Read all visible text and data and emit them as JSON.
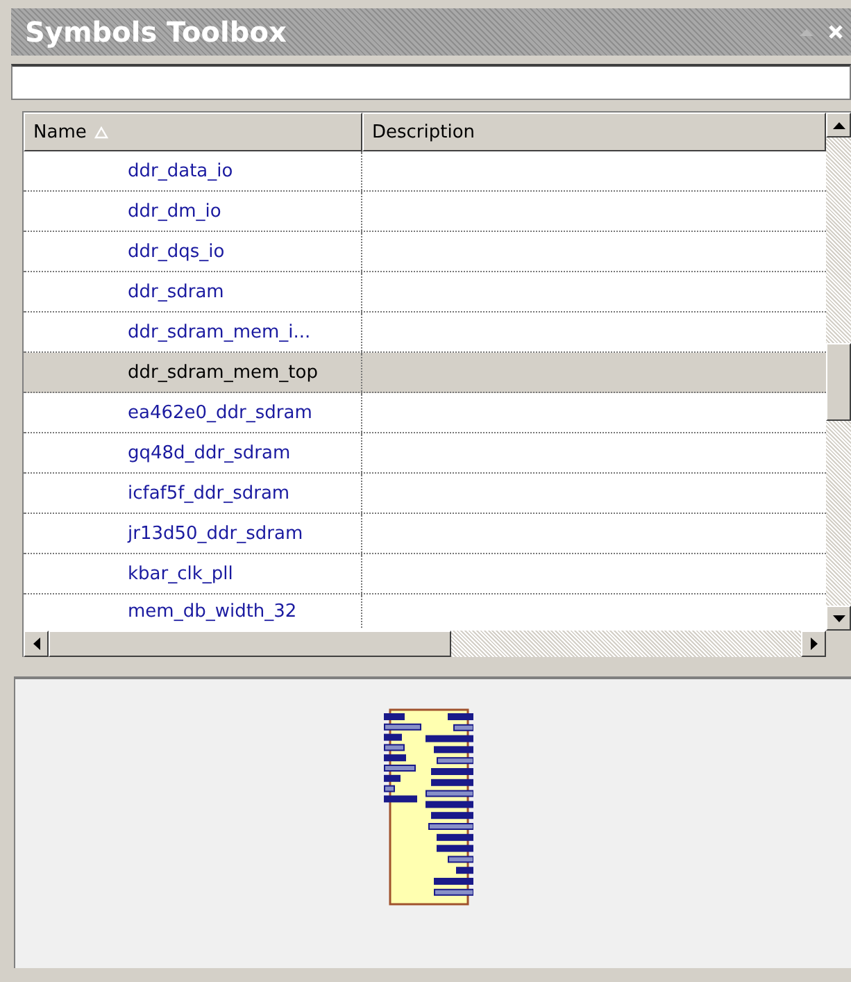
{
  "window": {
    "title": "Symbols Toolbox"
  },
  "table": {
    "columns": [
      {
        "label": "Name",
        "sorted": true
      },
      {
        "label": "Description",
        "sorted": false
      }
    ],
    "rows": [
      {
        "name": "ddr_data_io",
        "selected": false
      },
      {
        "name": "ddr_dm_io",
        "selected": false
      },
      {
        "name": "ddr_dqs_io",
        "selected": false
      },
      {
        "name": "ddr_sdram",
        "selected": false
      },
      {
        "name": "ddr_sdram_mem_i...",
        "selected": false
      },
      {
        "name": "ddr_sdram_mem_top",
        "selected": true
      },
      {
        "name": "ea462e0_ddr_sdram",
        "selected": false
      },
      {
        "name": "gq48d_ddr_sdram",
        "selected": false
      },
      {
        "name": "icfaf5f_ddr_sdram",
        "selected": false
      },
      {
        "name": "jr13d50_ddr_sdram",
        "selected": false
      },
      {
        "name": "kbar_clk_pll",
        "selected": false
      },
      {
        "name": "mem_db_width_32",
        "selected": false
      }
    ]
  }
}
